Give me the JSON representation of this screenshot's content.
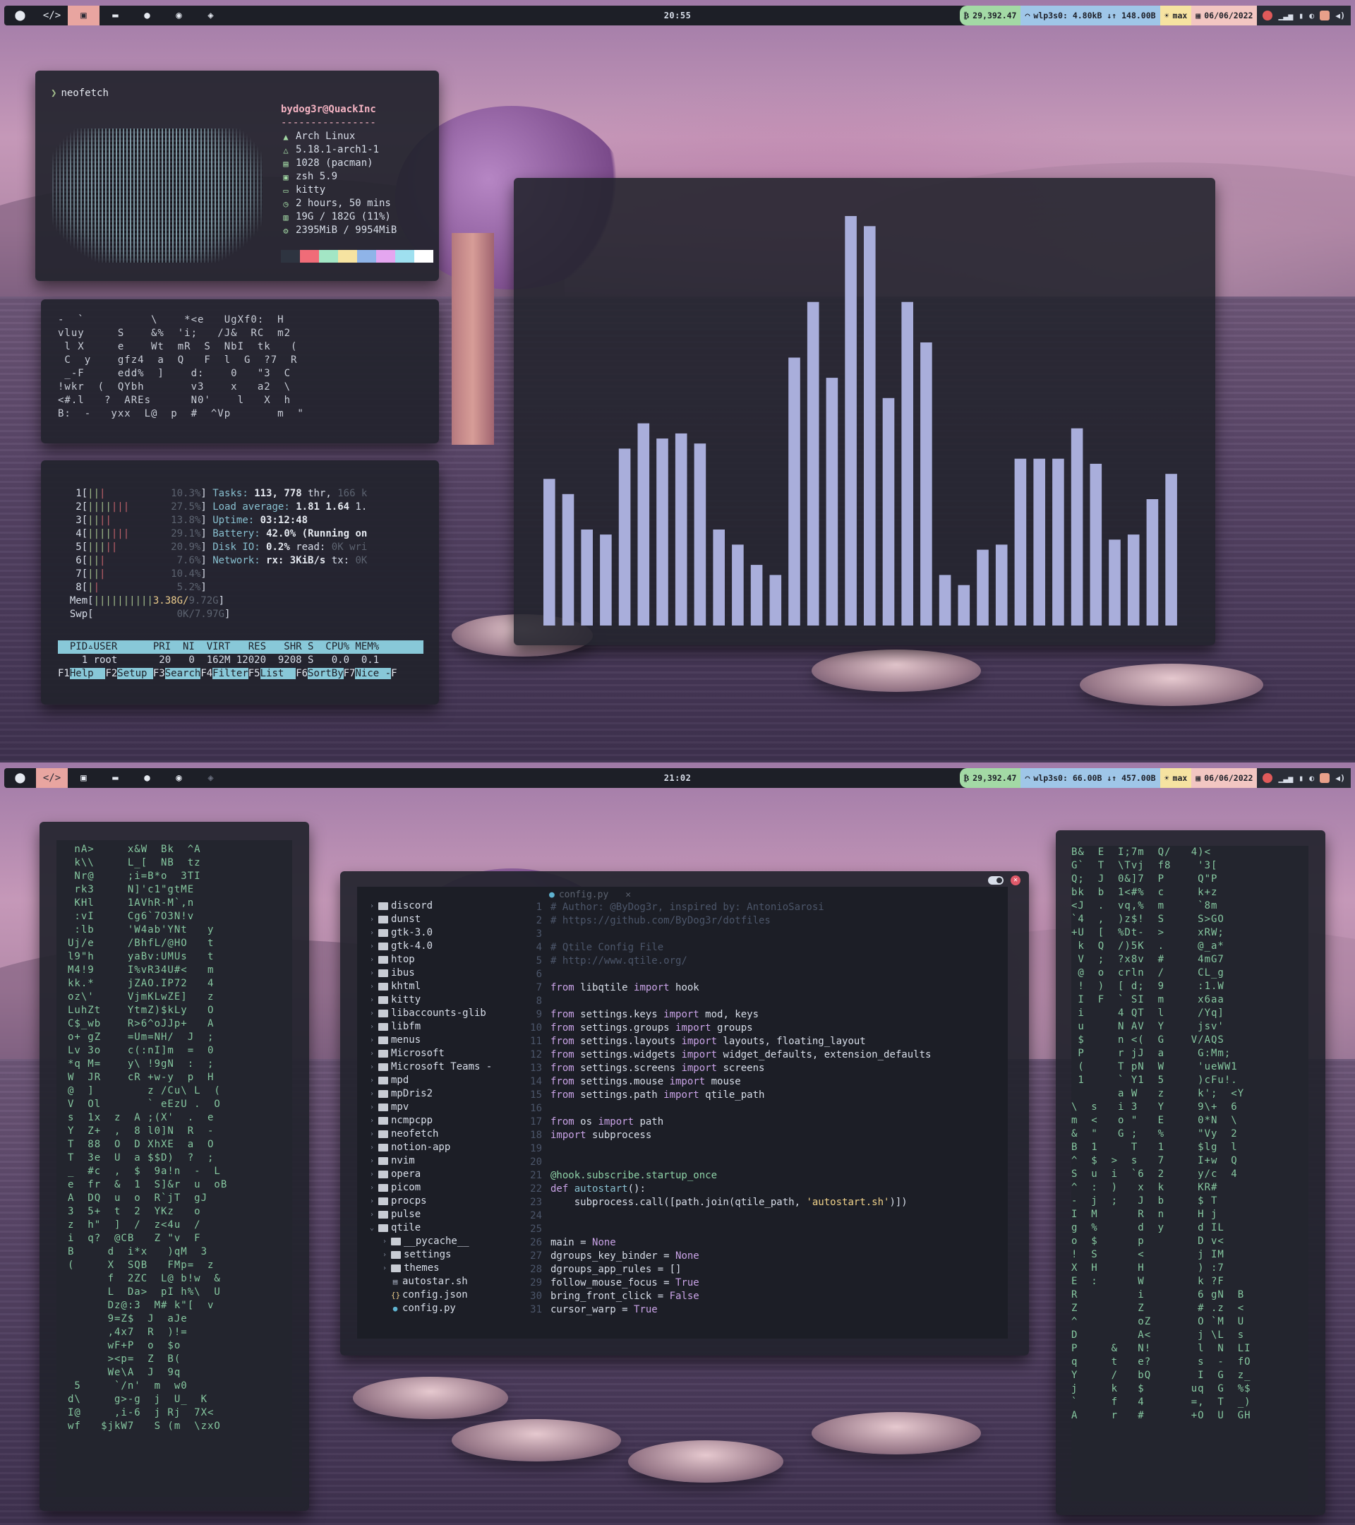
{
  "screens": [
    {
      "bar": {
        "clock": "20:55",
        "btc": "29,392.47",
        "net": "wlp3s0:",
        "down": "4.80kB",
        "up": "148.00B",
        "brightness": "max",
        "date": "06/06/2022"
      }
    },
    {
      "bar": {
        "clock": "21:02",
        "btc": "29,392.47",
        "net": "wlp3s0:",
        "down": "66.00B",
        "up": "457.00B",
        "brightness": "max",
        "date": "06/06/2022"
      }
    }
  ],
  "workspace_icons": [
    "arch-icon",
    "code-icon",
    "terminal-icon",
    "folder-icon",
    "chat-icon",
    "spotify-icon",
    "layers-icon"
  ],
  "neofetch": {
    "prompt": "neofetch",
    "host": "bydog3r@QuackInc",
    "separator": "----------------",
    "rows": [
      {
        "icon": "arch-logo-icon",
        "text": "Arch Linux"
      },
      {
        "icon": "kernel-icon",
        "text": "5.18.1-arch1-1"
      },
      {
        "icon": "package-icon",
        "text": "1028 (pacman)"
      },
      {
        "icon": "shell-icon",
        "text": "zsh 5.9"
      },
      {
        "icon": "terminal-icon",
        "text": "kitty"
      },
      {
        "icon": "clock-icon",
        "text": "2 hours, 50 mins"
      },
      {
        "icon": "disk-icon",
        "text": "19G / 182G (11%)"
      },
      {
        "icon": "memory-icon",
        "text": "2395MiB / 9954MiB"
      }
    ],
    "palette": [
      "#2e3440",
      "#f06c78",
      "#a3e6c5",
      "#f6e3a1",
      "#8fb4e8",
      "#e4a6f0",
      "#9fe0f0",
      "#ffffff"
    ]
  },
  "matrix_small": [
    "-  `          \\    *<e   UgXf0:  H",
    "vluy     S    &%  'i;   /J&  RC  m2",
    " l X     e    Wt  mR  S  NbI  tk   (",
    " C  y    gfz4  a  Q   F  l  G  ?7  R",
    " _-F     edd%  ]    d:    0   \"3  C",
    "!wkr  (  QYbh       v3    x   a2  \\",
    "<#.l   ?  AREs      N0'    l   X  h",
    "B:  -   yxx  L@  p  #  ^Vp       m  \""
  ],
  "htop": {
    "cpus": [
      {
        "id": "1",
        "bar": "|||",
        "pct": "10.3%"
      },
      {
        "id": "2",
        "bar": "|||||||",
        "pct": "27.5%"
      },
      {
        "id": "3",
        "bar": "||||",
        "pct": "13.8%"
      },
      {
        "id": "4",
        "bar": "|||||||",
        "pct": "29.1%"
      },
      {
        "id": "5",
        "bar": "|||||",
        "pct": "20.9%"
      },
      {
        "id": "6",
        "bar": "|||",
        "pct": "7.6%"
      },
      {
        "id": "7",
        "bar": "|||",
        "pct": "10.4%"
      },
      {
        "id": "8",
        "bar": "||",
        "pct": "5.2%"
      }
    ],
    "mem": "3.38G/",
    "mem_total": "9.72G",
    "swp": "0K/7.97G",
    "info": [
      {
        "label": "Tasks: ",
        "value": "113, 778",
        "rest": " thr, ",
        "dim": "166 k"
      },
      {
        "label": "Load average: ",
        "value": "1.81 1.64",
        "rest": " 1.",
        "dim": ""
      },
      {
        "label": "Uptime: ",
        "value": "03:12:48",
        "rest": "",
        "dim": ""
      },
      {
        "label": "Battery: ",
        "value": "42.0% (Running on",
        "rest": "",
        "dim": ""
      },
      {
        "label": "Disk IO: ",
        "value": "0.2%",
        "rest": " read: ",
        "dim": "0K wri"
      },
      {
        "label": "Network: ",
        "value": "rx: 3KiB/s",
        "rest": " tx: ",
        "dim": "0K"
      }
    ],
    "header": "  PID▵USER      PRI  NI  VIRT   RES   SHR S  CPU% MEM%",
    "row": "    1 root       20   0  162M 12020  9208 S   0.0  0.1",
    "keys": [
      {
        "k": "F1",
        "v": "Help  "
      },
      {
        "k": "F2",
        "v": "Setup "
      },
      {
        "k": "F3",
        "v": "Search"
      },
      {
        "k": "F4",
        "v": "Filter"
      },
      {
        "k": "F5",
        "v": "List  "
      },
      {
        "k": "F6",
        "v": "SortBy"
      },
      {
        "k": "F7",
        "v": "Nice -"
      },
      {
        "k": "F",
        "v": ""
      }
    ]
  },
  "chart_data": {
    "type": "bar",
    "values": [
      29,
      26,
      19,
      18,
      35,
      40,
      37,
      38,
      36,
      19,
      16,
      12,
      10,
      53,
      64,
      49,
      81,
      79,
      45,
      64,
      56,
      10,
      8,
      15,
      16,
      33,
      33,
      33,
      39,
      32,
      17,
      18,
      25,
      30
    ],
    "color": "#a9aedb"
  },
  "matrix_left": [
    " nA>     x&W  Bk  ^A",
    " k\\\\     L_[  NB  tz",
    " Nr@     ;i=B*o  3TI",
    " rk3     N]'c1\"gtME",
    " KHl     1AVhR-M`,n",
    " :vI     Cg6`7O3N!v",
    " :lb     'W4ab'YNt   y",
    "Uj/e     /BhfL/@HO   t",
    "l9\"h     yaBv:UMUs   t",
    "M4!9     I%vR34U#<   m",
    "kk.*     jZAO.IP72   4",
    "oz\\'     VjmKLwZE]   z",
    "LuhZt    YtmZ)$kLy   O",
    "C$_wb    R>6^oJJp+   A",
    "o+ gZ    =Um=NH/  J  ;",
    "Lv 3o    c(:nI]m  =  0",
    "*q M=    y\\ !9gN  :  ;",
    "W  JR    cR +w-y  p  H",
    "@  ]        z /Cu\\ L  (",
    "V  Ol       ` eEzU .  O",
    "s  1x  z  A ;(X'  .  e",
    "Y  Z+  ,  8 l0]N  R  -",
    "T  88  O  D XhXE  a  O",
    "T  3e  U  a $$D)  ?  ;",
    "_  #c  ,  $  9a!n  -  L",
    "e  fr  &  1  S]&r  u  oB",
    "A  DQ  u  o  R`jT  gJ",
    "3  5+  t  2  YKz   o",
    "z  h\"  ]  /  z<4u  /",
    "i  q?  @CB   Z \"v  F",
    "B     d  i*x   )qM  3",
    "(     X  SQB   FMp=  z",
    "      f  2ZC  L@ b!w  &",
    "      L  Da>  pI h%\\  U",
    "      Dz@:3  M# k\"[  v",
    "      9=Z$  J  aJe",
    "      ,4x7  R  )!=",
    "      wF+P  o  $o",
    "      ><p=  Z  B(",
    "      We\\A  J  9q",
    " 5     `/n'  m  w0",
    "d\\     g>-g  j  U_  K",
    "I@     ,i-6  j Rj  7X<",
    "wf   $jkW7   S (m  \\zxO"
  ],
  "matrix_right": [
    "B&  E  I;7m  Q/   4)<",
    "G`  T  \\Tvj  f8    '3[",
    "Q;  J  0&]7  P     Q\"P",
    "bk  b  1<#%  c     k+z",
    "<J  .  vq,%  m     `8m",
    "`4  ,  )z$!  S     S>GO",
    "+U  [  %Dt-  >     xRW;",
    " k  Q  /)5K  .     @_a*",
    " V  ;  ?x8v  #     4mG7",
    " @  o  crln  /     CL_g",
    " !  )  [ d;  9     :1.W",
    " I  F  ` SI  m     x6aa",
    " i     4 QT  l     /Yq]",
    " u     N AV  Y     jsv'",
    " $     n <(  G    V/AQS",
    " P     r jJ  a     G:Mm;",
    " (     T pN  W     'ueWW1",
    " 1     ` Y1  5     )cFu!.",
    "       a W   z     k';  <Y",
    "\\  s   i 3   Y     9\\+  6",
    "m  <   o \"   E     0*N  \\",
    "&  \"   G ;   %     \"Vy  2",
    "B  1     T   1     $lg  l",
    "^  $  >  s   7     I+w  Q",
    "S  u  i  `6  2     y/c  4",
    "^  :  )   x  k     KR#",
    "-  j  ;   J  b     $ T",
    "I  M      R  n     H j",
    "g  %      d  y     d IL",
    "o  $      p        D v<",
    "!  S      <        j IM",
    "X  H      H        ) :7",
    "E  :      W        k ?F",
    "R         i        6 gN  B",
    "Z         Z        # .z  <",
    "^         oZ       O `M  U",
    "D         A<       j \\L  s",
    "P     &   N!       l  N  LI",
    "q     t   e?       s  -  fO",
    "Y     /   bQ       I  G  z_",
    "j     k   $       uq  G  %$",
    "`     f   4       =,  T  _)",
    "A     r   #       +O  U  GH"
  ],
  "editor": {
    "tab": "config.py",
    "tree": [
      {
        "indent": 0,
        "chev": "›",
        "kind": "folder",
        "name": "discord"
      },
      {
        "indent": 0,
        "chev": "›",
        "kind": "folder",
        "name": "dunst"
      },
      {
        "indent": 0,
        "chev": "›",
        "kind": "folder",
        "name": "gtk-3.0"
      },
      {
        "indent": 0,
        "chev": "›",
        "kind": "folder",
        "name": "gtk-4.0"
      },
      {
        "indent": 0,
        "chev": "›",
        "kind": "folder",
        "name": "htop"
      },
      {
        "indent": 0,
        "chev": "›",
        "kind": "folder",
        "name": "ibus"
      },
      {
        "indent": 0,
        "chev": "›",
        "kind": "folder",
        "name": "khtml"
      },
      {
        "indent": 0,
        "chev": "›",
        "kind": "folder",
        "name": "kitty"
      },
      {
        "indent": 0,
        "chev": "›",
        "kind": "folder",
        "name": "libaccounts-glib"
      },
      {
        "indent": 0,
        "chev": "›",
        "kind": "folder",
        "name": "libfm"
      },
      {
        "indent": 0,
        "chev": "›",
        "kind": "folder",
        "name": "menus"
      },
      {
        "indent": 0,
        "chev": "›",
        "kind": "folder",
        "name": "Microsoft"
      },
      {
        "indent": 0,
        "chev": "›",
        "kind": "folder",
        "name": "Microsoft Teams -"
      },
      {
        "indent": 0,
        "chev": "›",
        "kind": "folder",
        "name": "mpd"
      },
      {
        "indent": 0,
        "chev": "›",
        "kind": "folder",
        "name": "mpDris2"
      },
      {
        "indent": 0,
        "chev": "›",
        "kind": "folder",
        "name": "mpv"
      },
      {
        "indent": 0,
        "chev": "›",
        "kind": "folder",
        "name": "ncmpcpp"
      },
      {
        "indent": 0,
        "chev": "›",
        "kind": "folder",
        "name": "neofetch"
      },
      {
        "indent": 0,
        "chev": "›",
        "kind": "folder",
        "name": "notion-app"
      },
      {
        "indent": 0,
        "chev": "›",
        "kind": "folder",
        "name": "nvim"
      },
      {
        "indent": 0,
        "chev": "›",
        "kind": "folder",
        "name": "opera"
      },
      {
        "indent": 0,
        "chev": "›",
        "kind": "folder",
        "name": "picom"
      },
      {
        "indent": 0,
        "chev": "›",
        "kind": "folder",
        "name": "procps"
      },
      {
        "indent": 0,
        "chev": "›",
        "kind": "folder",
        "name": "pulse"
      },
      {
        "indent": 0,
        "chev": "⌄",
        "kind": "folder",
        "name": "qtile"
      },
      {
        "indent": 1,
        "chev": "›",
        "kind": "folder",
        "name": "__pycache__"
      },
      {
        "indent": 1,
        "chev": "›",
        "kind": "folder",
        "name": "settings"
      },
      {
        "indent": 1,
        "chev": "›",
        "kind": "folder",
        "name": "themes"
      },
      {
        "indent": 1,
        "chev": "",
        "kind": "shell",
        "name": "autostar.sh"
      },
      {
        "indent": 1,
        "chev": "",
        "kind": "json",
        "name": "config.json"
      },
      {
        "indent": 1,
        "chev": "",
        "kind": "python",
        "name": "config.py"
      }
    ],
    "lines": [
      {
        "n": "1",
        "parts": [
          {
            "c": "cm",
            "t": "# Author: @ByDog3r, inspired by: AntonioSarosi"
          }
        ]
      },
      {
        "n": "2",
        "parts": [
          {
            "c": "cm",
            "t": "# https://github.com/ByDog3r/dotfiles"
          }
        ]
      },
      {
        "n": "3",
        "parts": []
      },
      {
        "n": "4",
        "parts": [
          {
            "c": "cm",
            "t": "# Qtile Config File"
          }
        ]
      },
      {
        "n": "5",
        "parts": [
          {
            "c": "cm",
            "t": "# http://www.qtile.org/"
          }
        ]
      },
      {
        "n": "6",
        "parts": []
      },
      {
        "n": "7",
        "parts": [
          {
            "c": "kw",
            "t": "from"
          },
          {
            "c": "tx",
            "t": " libqtile "
          },
          {
            "c": "kw",
            "t": "import"
          },
          {
            "c": "tx",
            "t": " hook"
          }
        ]
      },
      {
        "n": "8",
        "parts": []
      },
      {
        "n": "9",
        "parts": [
          {
            "c": "kw",
            "t": "from"
          },
          {
            "c": "tx",
            "t": " settings.keys "
          },
          {
            "c": "kw",
            "t": "import"
          },
          {
            "c": "tx",
            "t": " mod, keys"
          }
        ]
      },
      {
        "n": "10",
        "parts": [
          {
            "c": "kw",
            "t": "from"
          },
          {
            "c": "tx",
            "t": " settings.groups "
          },
          {
            "c": "kw",
            "t": "import"
          },
          {
            "c": "tx",
            "t": " groups"
          }
        ]
      },
      {
        "n": "11",
        "parts": [
          {
            "c": "kw",
            "t": "from"
          },
          {
            "c": "tx",
            "t": " settings.layouts "
          },
          {
            "c": "kw",
            "t": "import"
          },
          {
            "c": "tx",
            "t": " layouts, floating_layout"
          }
        ]
      },
      {
        "n": "12",
        "parts": [
          {
            "c": "kw",
            "t": "from"
          },
          {
            "c": "tx",
            "t": " settings.widgets "
          },
          {
            "c": "kw",
            "t": "import"
          },
          {
            "c": "tx",
            "t": " widget_defaults, extension_defaults"
          }
        ]
      },
      {
        "n": "13",
        "parts": [
          {
            "c": "kw",
            "t": "from"
          },
          {
            "c": "tx",
            "t": " settings.screens "
          },
          {
            "c": "kw",
            "t": "import"
          },
          {
            "c": "tx",
            "t": " screens"
          }
        ]
      },
      {
        "n": "14",
        "parts": [
          {
            "c": "kw",
            "t": "from"
          },
          {
            "c": "tx",
            "t": " settings.mouse "
          },
          {
            "c": "kw",
            "t": "import"
          },
          {
            "c": "tx",
            "t": " mouse"
          }
        ]
      },
      {
        "n": "15",
        "parts": [
          {
            "c": "kw",
            "t": "from"
          },
          {
            "c": "tx",
            "t": " settings.path "
          },
          {
            "c": "kw",
            "t": "import"
          },
          {
            "c": "tx",
            "t": " qtile_path"
          }
        ]
      },
      {
        "n": "16",
        "parts": []
      },
      {
        "n": "17",
        "parts": [
          {
            "c": "kw",
            "t": "from"
          },
          {
            "c": "tx",
            "t": " os "
          },
          {
            "c": "kw",
            "t": "import"
          },
          {
            "c": "tx",
            "t": " path"
          }
        ]
      },
      {
        "n": "18",
        "parts": [
          {
            "c": "kw",
            "t": "import"
          },
          {
            "c": "tx",
            "t": " subprocess"
          }
        ]
      },
      {
        "n": "19",
        "parts": []
      },
      {
        "n": "20",
        "parts": []
      },
      {
        "n": "21",
        "parts": [
          {
            "c": "dec",
            "t": "@hook.subscribe.startup_once"
          }
        ]
      },
      {
        "n": "22",
        "parts": [
          {
            "c": "kw",
            "t": "def"
          },
          {
            "c": "tx",
            "t": " "
          },
          {
            "c": "fn",
            "t": "autostart"
          },
          {
            "c": "tx",
            "t": "():"
          }
        ]
      },
      {
        "n": "23",
        "parts": [
          {
            "c": "tx",
            "t": "    subprocess.call([path.join(qtile_path, "
          },
          {
            "c": "st",
            "t": "'autostart.sh'"
          },
          {
            "c": "tx",
            "t": ")])"
          }
        ]
      },
      {
        "n": "24",
        "parts": []
      },
      {
        "n": "25",
        "parts": []
      },
      {
        "n": "26",
        "parts": [
          {
            "c": "tx",
            "t": "main = "
          },
          {
            "c": "kw",
            "t": "None"
          }
        ]
      },
      {
        "n": "27",
        "parts": [
          {
            "c": "tx",
            "t": "dgroups_key_binder = "
          },
          {
            "c": "kw",
            "t": "None"
          }
        ]
      },
      {
        "n": "28",
        "parts": [
          {
            "c": "tx",
            "t": "dgroups_app_rules = []"
          }
        ]
      },
      {
        "n": "29",
        "parts": [
          {
            "c": "tx",
            "t": "follow_mouse_focus = "
          },
          {
            "c": "kw",
            "t": "True"
          }
        ]
      },
      {
        "n": "30",
        "parts": [
          {
            "c": "tx",
            "t": "bring_front_click = "
          },
          {
            "c": "kw",
            "t": "False"
          }
        ]
      },
      {
        "n": "31",
        "parts": [
          {
            "c": "tx",
            "t": "cursor_warp = "
          },
          {
            "c": "kw",
            "t": "True"
          }
        ]
      }
    ]
  }
}
